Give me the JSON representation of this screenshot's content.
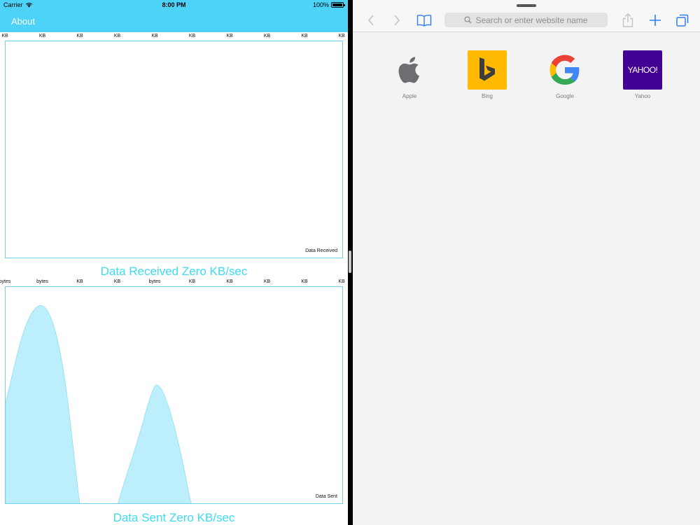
{
  "status_bar": {
    "carrier": "Carrier",
    "time": "8:00 PM",
    "battery": "100%"
  },
  "nav": {
    "about_label": "About"
  },
  "received": {
    "ticks": [
      "KB",
      "KB",
      "KB",
      "KB",
      "KB",
      "KB",
      "KB",
      "KB",
      "KB",
      "KB"
    ],
    "corner_label": "Data Received",
    "title": "Data Received Zero KB/sec"
  },
  "sent": {
    "ticks": [
      "bytes",
      "bytes",
      "KB",
      "KB",
      "bytes",
      "KB",
      "KB",
      "KB",
      "KB",
      "KB"
    ],
    "corner_label": "Data Sent",
    "title": "Data Sent Zero KB/sec",
    "fill_color": "#bdeefb",
    "stroke_color": "#8fdff5"
  },
  "safari": {
    "search_placeholder": "Search or enter website name",
    "accent_color": "#2f7df6",
    "favorites": [
      {
        "label": "Apple",
        "icon": "apple-icon"
      },
      {
        "label": "Bing",
        "icon": "bing-icon",
        "color": "#ffb900"
      },
      {
        "label": "Google",
        "icon": "google-icon"
      },
      {
        "label": "Yahoo",
        "icon": "yahoo-icon",
        "color": "#410093",
        "tile_text": "YAHOO!"
      }
    ]
  },
  "theme": {
    "nav_color": "#4dd2f8",
    "title_color": "#3ddcf0"
  }
}
